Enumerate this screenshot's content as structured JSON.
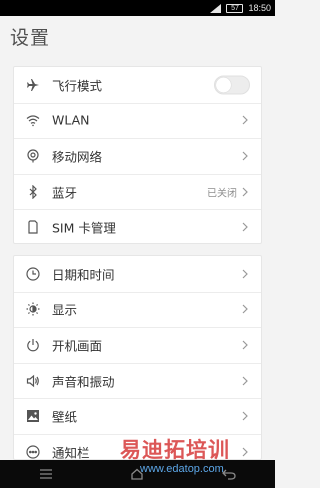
{
  "status_bar": {
    "time": "18:50",
    "battery": "57"
  },
  "page": {
    "title": "设置"
  },
  "groups": {
    "network": [
      {
        "label": "飞行模式",
        "icon": "airplane-icon",
        "toggle": "off"
      },
      {
        "label": "WLAN",
        "icon": "wifi-icon"
      },
      {
        "label": "移动网络",
        "icon": "mobile-network-icon"
      },
      {
        "label": "蓝牙",
        "icon": "bluetooth-icon",
        "value": "已关闭"
      },
      {
        "label": "SIM 卡管理",
        "icon": "sim-card-icon"
      }
    ],
    "device": [
      {
        "label": "日期和时间",
        "icon": "clock-icon"
      },
      {
        "label": "显示",
        "icon": "brightness-icon"
      },
      {
        "label": "开机画面",
        "icon": "power-icon"
      },
      {
        "label": "声音和振动",
        "icon": "speaker-icon"
      },
      {
        "label": "壁纸",
        "icon": "image-icon"
      },
      {
        "label": "通知栏",
        "icon": "notification-icon"
      }
    ]
  },
  "watermark": {
    "text": "易迪拓培训",
    "url": "www.edatop.com"
  },
  "colors": {
    "background": "#f3f3f3",
    "card": "#ffffff",
    "text": "#333333",
    "secondary_text": "#8e8e8e",
    "watermark": "#d63a3a"
  }
}
